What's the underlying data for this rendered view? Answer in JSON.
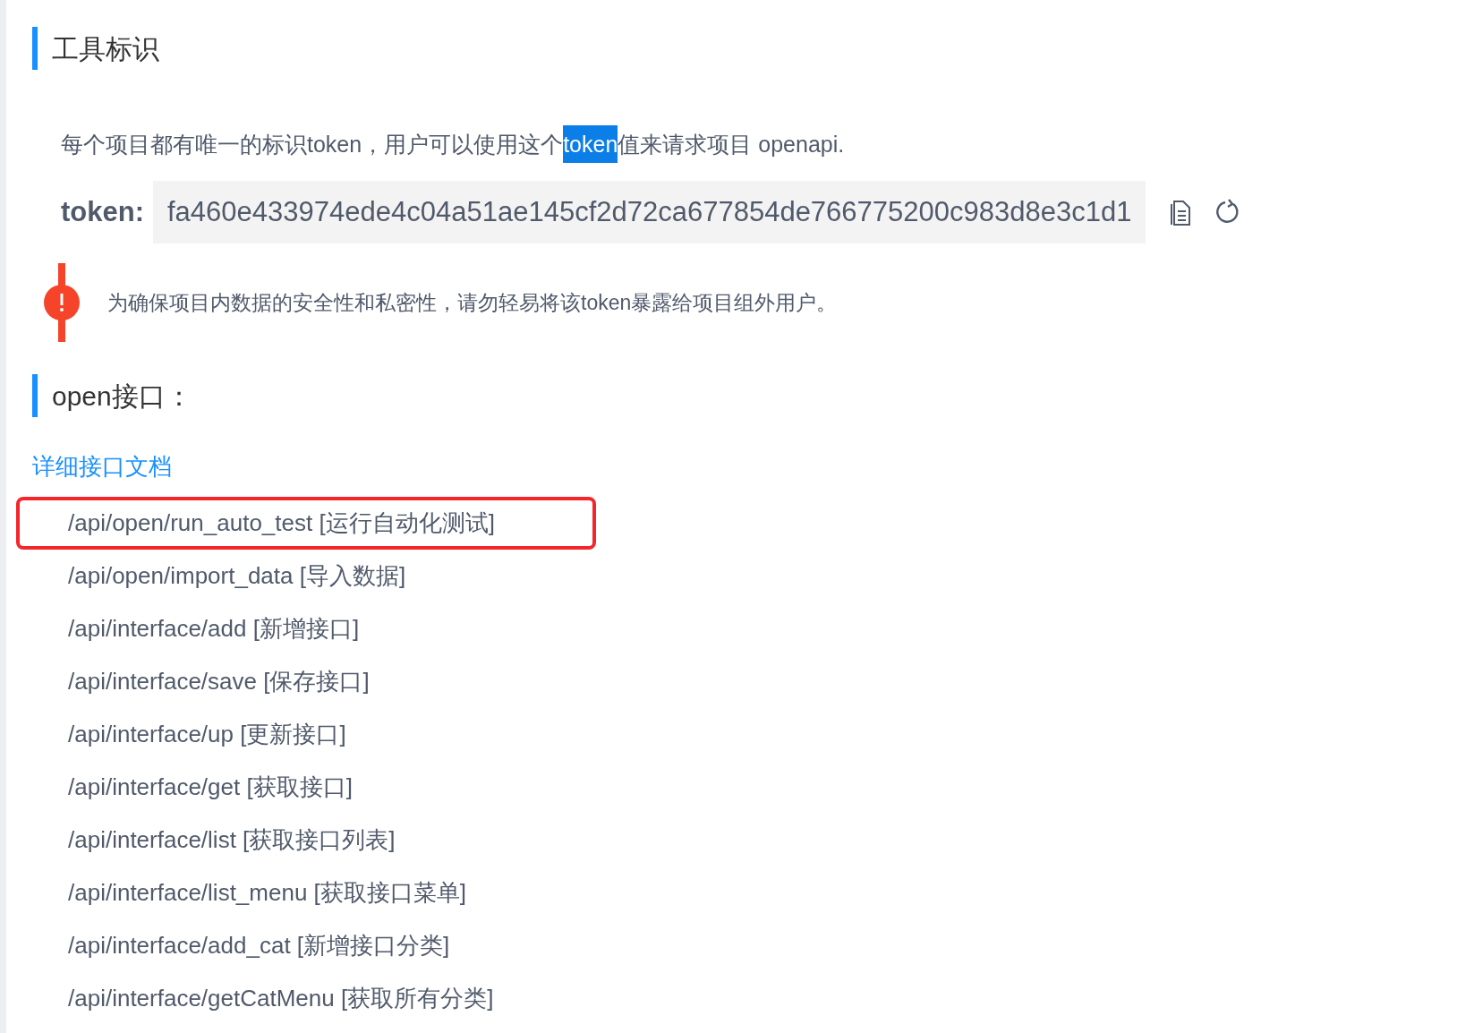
{
  "tool_section": {
    "title": "工具标识",
    "description": {
      "before": "每个项目都有唯一的标识token，用户可以使用这个",
      "selected_text": "token",
      "after": "值来请求项目 openapi."
    },
    "token": {
      "label": "token:",
      "value": "fa460e433974ede4c04a51ae145cf2d72ca677854de766775200c983d8e3c1d1"
    },
    "warning": "为确保项目内数据的安全性和私密性，请勿轻易将该token暴露给项目组外用户。"
  },
  "open_section": {
    "title": "open接口：",
    "doc_link": "详细接口文档",
    "endpoints": [
      {
        "text": "/api/open/run_auto_test [运行自动化测试]",
        "highlighted": true
      },
      {
        "text": "/api/open/import_data [导入数据]",
        "highlighted": false
      },
      {
        "text": "/api/interface/add [新增接口]",
        "highlighted": false
      },
      {
        "text": "/api/interface/save [保存接口]",
        "highlighted": false
      },
      {
        "text": "/api/interface/up [更新接口]",
        "highlighted": false
      },
      {
        "text": "/api/interface/get [获取接口]",
        "highlighted": false
      },
      {
        "text": "/api/interface/list [获取接口列表]",
        "highlighted": false
      },
      {
        "text": "/api/interface/list_menu [获取接口菜单]",
        "highlighted": false
      },
      {
        "text": "/api/interface/add_cat [新增接口分类]",
        "highlighted": false
      },
      {
        "text": "/api/interface/getCatMenu [获取所有分类]",
        "highlighted": false
      }
    ]
  }
}
